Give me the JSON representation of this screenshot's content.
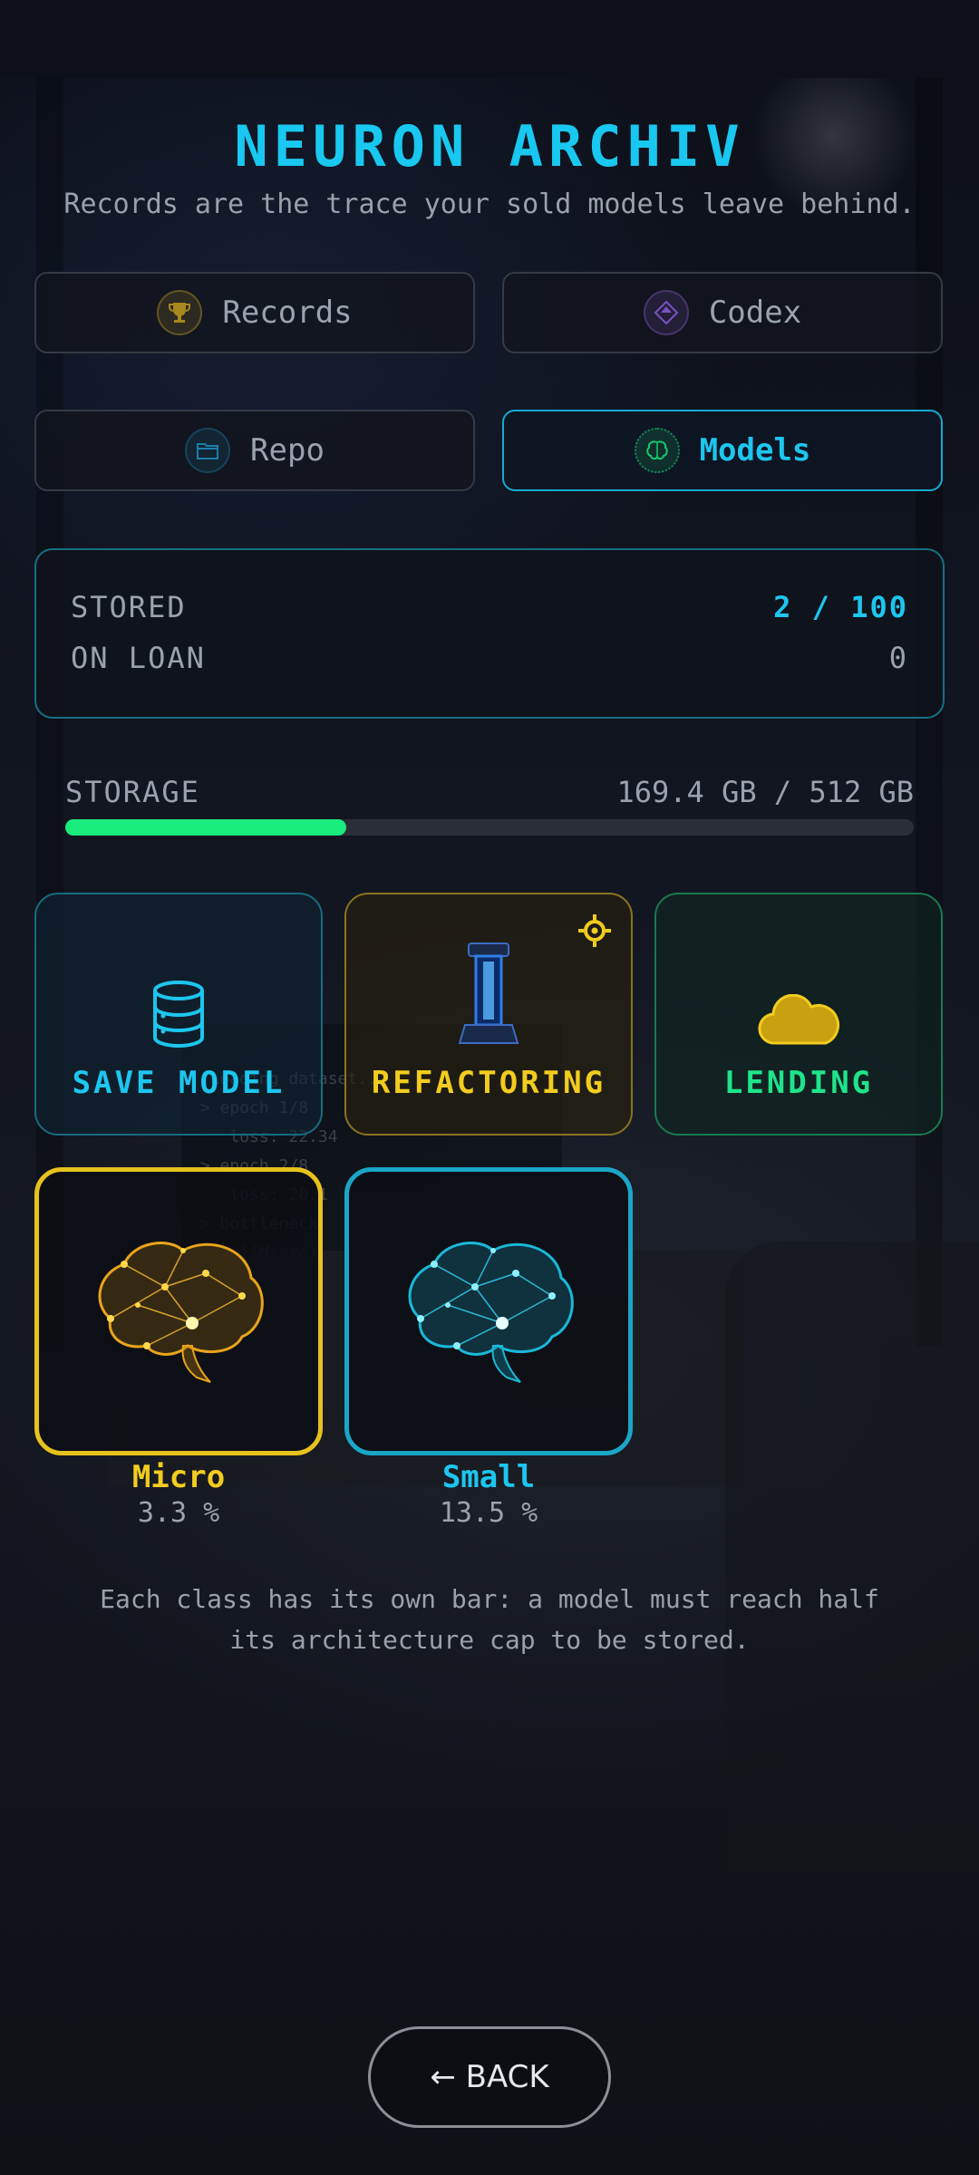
{
  "header": {
    "title": "NEURON ARCHIV",
    "subtitle": "Records are the trace your sold models leave behind."
  },
  "tabs": [
    {
      "label": "Records",
      "icon": "trophy-icon",
      "color": "#c9a227",
      "active": false
    },
    {
      "label": "Codex",
      "icon": "diamond-icon",
      "color": "#8a5cd8",
      "active": false
    },
    {
      "label": "Repo",
      "icon": "folder-icon",
      "color": "#1a7fa8",
      "active": false
    },
    {
      "label": "Models",
      "icon": "brain-icon",
      "color": "#19c86e",
      "active": true
    }
  ],
  "stats": {
    "stored_label": "STORED",
    "stored_value": "2 / 100",
    "on_loan_label": "ON LOAN",
    "on_loan_value": "0"
  },
  "storage": {
    "label": "STORAGE",
    "value": "169.4 GB / 512 GB",
    "fill_fraction": 0.331,
    "bar_color": "#19ec7d"
  },
  "actions": [
    {
      "label": "SAVE MODEL",
      "icon": "database-icon",
      "color": "#1dc6ef"
    },
    {
      "label": "REFACTORING",
      "icon": "capacitor-icon",
      "color": "#f2cc1e",
      "badge_icon": "gear-icon"
    },
    {
      "label": "LENDING",
      "icon": "cloud-icon",
      "color": "#1fe48a"
    }
  ],
  "models": [
    {
      "name": "Micro",
      "percent": "3.3 %",
      "color": "#f2cc1e"
    },
    {
      "name": "Small",
      "percent": "13.5 %",
      "color": "#1dc6ef"
    }
  ],
  "note": "Each class has its own bar: a model must reach half its architecture cap to be stored.",
  "back_label": "← BACK"
}
